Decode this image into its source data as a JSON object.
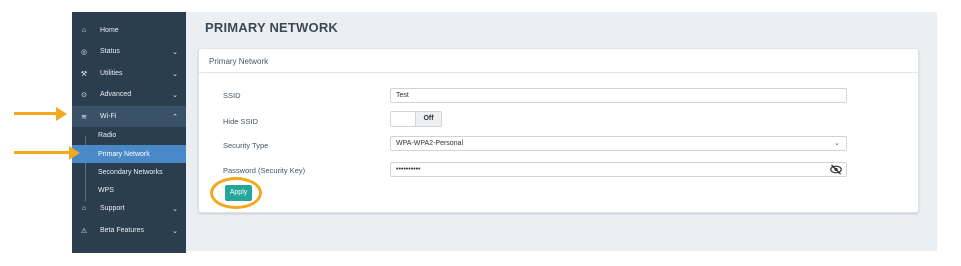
{
  "page": {
    "title": "PRIMARY NETWORK"
  },
  "sidebar": {
    "items": [
      {
        "label": "Home",
        "icon": "home-icon",
        "glyph": "⌂"
      },
      {
        "label": "Status",
        "icon": "status-icon",
        "glyph": "◎",
        "chevron": "⌄"
      },
      {
        "label": "Utilities",
        "icon": "wrench-icon",
        "glyph": "⚒",
        "chevron": "⌄"
      },
      {
        "label": "Advanced",
        "icon": "advanced-icon",
        "glyph": "⊙",
        "chevron": "⌄"
      },
      {
        "label": "Wi-Fi",
        "icon": "wifi-icon",
        "glyph": "≋",
        "chevron": "⌃"
      },
      {
        "label": "Support",
        "icon": "support-icon",
        "glyph": "⌂",
        "chevron": "⌄"
      },
      {
        "label": "Beta Features",
        "icon": "beta-icon",
        "glyph": "⚠",
        "chevron": "⌄"
      }
    ],
    "wifi_sub": [
      {
        "label": "Radio"
      },
      {
        "label": "Primary Network",
        "active": true
      },
      {
        "label": "Secondary Networks"
      },
      {
        "label": "WPS"
      }
    ]
  },
  "card": {
    "header": "Primary Network",
    "fields": {
      "ssid_label": "SSID",
      "ssid_value": "Test",
      "hide_ssid_label": "Hide SSID",
      "hide_ssid_state": "Off",
      "security_type_label": "Security Type",
      "security_type_value": "WPA-WPA2-Personal",
      "password_label": "Password (Security Key)",
      "password_value": "••••••••••"
    },
    "apply_label": "Apply"
  },
  "colors": {
    "sidebar": "#2b3e50",
    "active": "#4a89c8",
    "apply": "#26a69a",
    "annotation": "#f4a81c"
  }
}
